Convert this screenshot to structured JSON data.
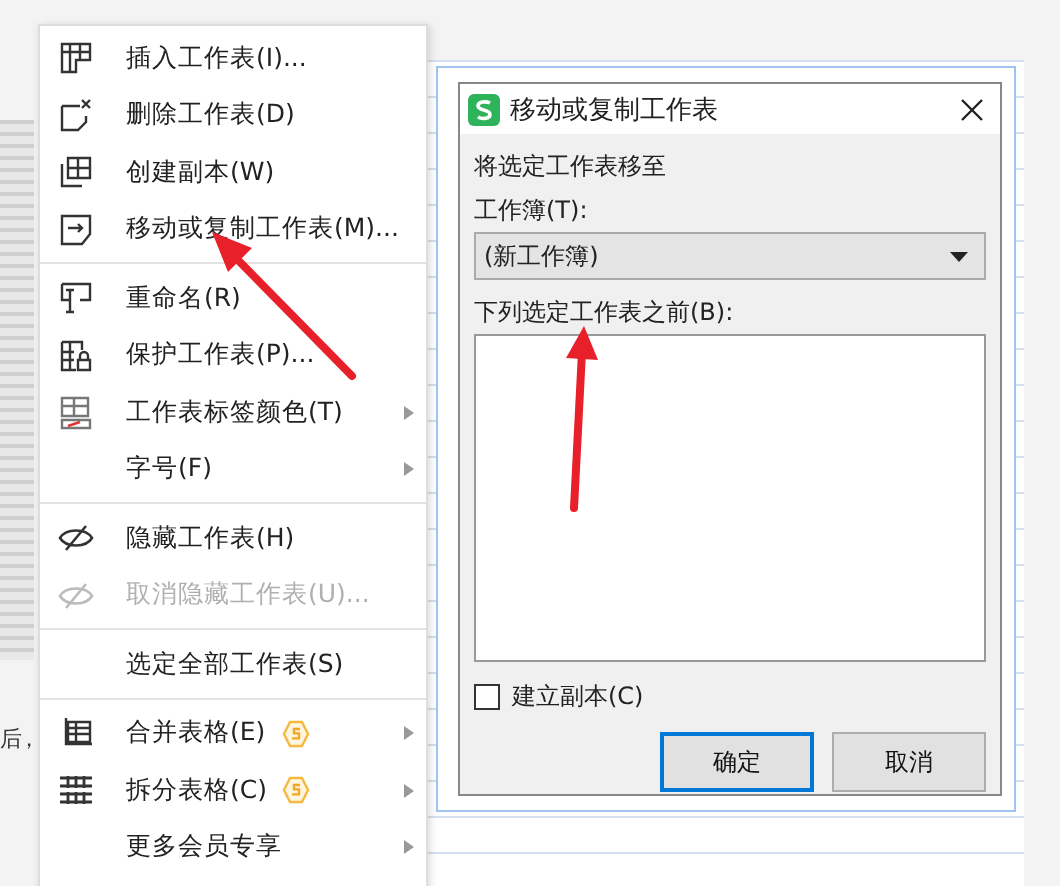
{
  "background_text": "后，",
  "context_menu": {
    "items": [
      {
        "kind": "item",
        "label": "插入工作表(I)...",
        "disabled": false,
        "submenu": false,
        "vip": false
      },
      {
        "kind": "item",
        "label": "删除工作表(D)",
        "disabled": false,
        "submenu": false,
        "vip": false
      },
      {
        "kind": "item",
        "label": "创建副本(W)",
        "disabled": false,
        "submenu": false,
        "vip": false
      },
      {
        "kind": "item",
        "label": "移动或复制工作表(M)...",
        "disabled": false,
        "submenu": false,
        "vip": false
      },
      {
        "kind": "separator"
      },
      {
        "kind": "item",
        "label": "重命名(R)",
        "disabled": false,
        "submenu": false,
        "vip": false
      },
      {
        "kind": "item",
        "label": "保护工作表(P)...",
        "disabled": false,
        "submenu": false,
        "vip": false
      },
      {
        "kind": "item",
        "label": "工作表标签颜色(T)",
        "disabled": false,
        "submenu": true,
        "vip": false
      },
      {
        "kind": "item",
        "label": "字号(F)",
        "disabled": false,
        "submenu": true,
        "vip": false
      },
      {
        "kind": "separator"
      },
      {
        "kind": "item",
        "label": "隐藏工作表(H)",
        "disabled": false,
        "submenu": false,
        "vip": false
      },
      {
        "kind": "item",
        "label": "取消隐藏工作表(U)...",
        "disabled": true,
        "submenu": false,
        "vip": false
      },
      {
        "kind": "separator"
      },
      {
        "kind": "item",
        "label": "选定全部工作表(S)",
        "disabled": false,
        "submenu": false,
        "vip": false
      },
      {
        "kind": "separator"
      },
      {
        "kind": "item",
        "label": "合并表格(E)",
        "disabled": false,
        "submenu": true,
        "vip": true
      },
      {
        "kind": "item",
        "label": "拆分表格(C)",
        "disabled": false,
        "submenu": true,
        "vip": true
      },
      {
        "kind": "item",
        "label": "更多会员专享",
        "disabled": false,
        "submenu": true,
        "vip": false
      }
    ]
  },
  "dialog": {
    "title": "移动或复制工作表",
    "move_to_label": "将选定工作表移至",
    "workbook_label": "工作簿(T):",
    "workbook_value": "(新工作簿)",
    "before_sheet_label": "下列选定工作表之前(B):",
    "copy_checkbox": {
      "label": "建立副本(C)",
      "checked": false
    },
    "buttons": [
      {
        "label": "确定",
        "focused": true
      },
      {
        "label": "取消",
        "focused": false
      }
    ]
  }
}
